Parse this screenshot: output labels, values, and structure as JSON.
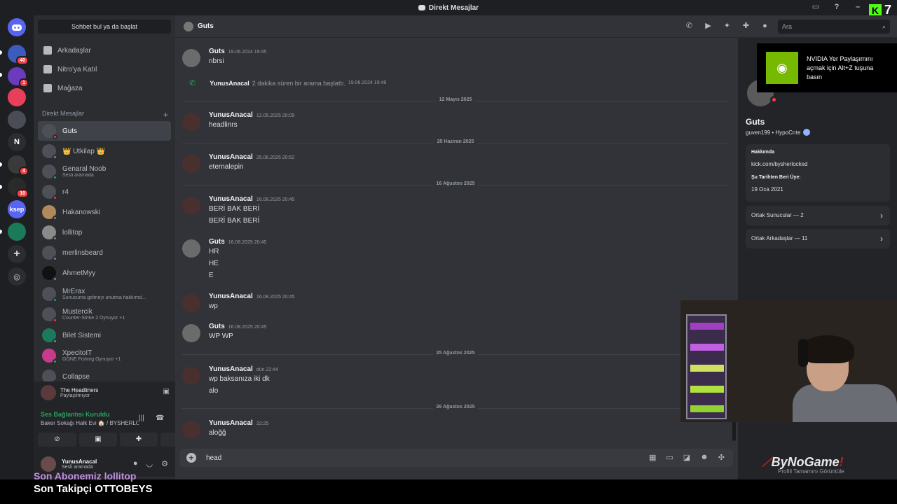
{
  "window": {
    "title": "Direkt Mesajlar"
  },
  "kick": {
    "label": "K",
    "count": "7"
  },
  "servers": [
    {
      "name": "Discord",
      "color": "#5865f2",
      "badge": ""
    },
    {
      "name": "S1",
      "color": "#3b5bbf",
      "badge": "40"
    },
    {
      "name": "S2",
      "color": "#6a3bbf",
      "badge": "1"
    },
    {
      "name": "S3",
      "color": "#e8405a",
      "badge": ""
    },
    {
      "name": "S4",
      "color": "#4a4d55",
      "badge": ""
    },
    {
      "name": "N",
      "color": "#2b2d31",
      "badge": ""
    },
    {
      "name": "S6",
      "color": "#3a3a3a",
      "badge": "4"
    },
    {
      "name": "S7",
      "color": "#2a2a2a",
      "badge": "10"
    },
    {
      "name": "ksep",
      "color": "#5865f2",
      "badge": ""
    },
    {
      "name": "S9",
      "color": "#1a7a5a",
      "badge": ""
    }
  ],
  "sidebar": {
    "search_label": "Sohbet bul ya da başlat",
    "nav": [
      {
        "label": "Arkadaşlar",
        "icon": "friends-icon"
      },
      {
        "label": "Nitro'ya Katıl",
        "icon": "nitro-icon"
      },
      {
        "label": "Mağaza",
        "icon": "shop-icon"
      }
    ],
    "dm_header": "Direkt Mesajlar",
    "dm_add": "+",
    "dms": [
      {
        "name": "Guts",
        "sub": "",
        "status": "dnd",
        "active": true
      },
      {
        "name": "👑 Utkilap 👑",
        "sub": "",
        "status": "off",
        "active": false
      },
      {
        "name": "Genaral Noob",
        "sub": "Sesli aramada",
        "status": "on",
        "active": false
      },
      {
        "name": "r4",
        "sub": "",
        "status": "dnd",
        "active": false
      },
      {
        "name": "Hakanowski",
        "sub": "",
        "status": "off",
        "active": false
      },
      {
        "name": "lollitop",
        "sub": "",
        "status": "off",
        "active": false
      },
      {
        "name": "merlinsbeard",
        "sub": "",
        "status": "off",
        "active": false
      },
      {
        "name": "AhmetMyy",
        "sub": "",
        "status": "off",
        "active": false
      },
      {
        "name": "MrErax",
        "sub": "Sunucuma gelmeyi unutma hakkımd...",
        "status": "on",
        "active": false
      },
      {
        "name": "Mustercik",
        "sub": "Counter-Strike 2 Oynuyor +1",
        "status": "dnd",
        "active": false
      },
      {
        "name": "Bilet Sistemi",
        "sub": "",
        "status": "off",
        "active": false
      },
      {
        "name": "XpecitoIT",
        "sub": "GONE Fishing Oynuyor +1",
        "status": "on",
        "active": false
      },
      {
        "name": "Collapse",
        "sub": "",
        "status": "off",
        "active": false
      }
    ]
  },
  "voice": {
    "stream_title": "The Headliners",
    "stream_sub": "Paylaşılmıyor",
    "connected": "Ses Bağlantısı Kuruldu",
    "channel": "Baker Sokağı Halk Evi 🏠 / BYSHERLO..."
  },
  "user": {
    "name": "YunusAnacal",
    "status": "Sesli aramada"
  },
  "overlay": {
    "line1": "Son Abonemiz lollitop",
    "line2": "Son Takipçi OTTOBEYS"
  },
  "chat": {
    "name": "Guts",
    "search_placeholder": "Ara",
    "composer_text": "head",
    "messages": [
      {
        "author": "Guts",
        "time": "19.06.2024 19:45",
        "lines": [
          "nbrsi"
        ]
      },
      {
        "author": "YunusAnacal",
        "time": "12.05.2025 20:09",
        "lines": [
          "headlinrs"
        ]
      },
      {
        "author": "YunusAnacal",
        "time": "25.06.2025 20:52",
        "lines": [
          "eternalepin"
        ]
      },
      {
        "author": "YunusAnacal",
        "time": "16.08.2025 20:45",
        "lines": [
          "BERİ BAK BERİ",
          "BERİ BAK BERİ"
        ]
      },
      {
        "author": "Guts",
        "time": "16.08.2025 20:45",
        "lines": [
          "HR",
          "HE",
          "E"
        ]
      },
      {
        "author": "YunusAnacal",
        "time": "16.08.2025 20:45",
        "lines": [
          "wp"
        ]
      },
      {
        "author": "Guts",
        "time": "16.08.2025 20:45",
        "lines": [
          "WP WP"
        ]
      },
      {
        "author": "YunusAnacal",
        "time": "dün 22:44",
        "lines": [
          "wp baksanıza iki dk",
          "alo"
        ]
      },
      {
        "author": "YunusAnacal",
        "time": "22:25",
        "lines": [
          "aloğğ"
        ]
      }
    ],
    "system": {
      "author": "YunusAnacal",
      "text": "2 dakika süren bir arama başlattı.",
      "time": "19.06.2024 19:48"
    },
    "dividers": [
      "12 Mayıs 2025",
      "25 Haziran 2025",
      "16 Ağustos 2025",
      "25 Ağustos 2025",
      "26 Ağustos 2025"
    ]
  },
  "profile": {
    "name": "Guts",
    "tag": "guven199 • HypoCrıte",
    "about_label": "Hakkımda",
    "about_value": "kick.com/bysherlocked",
    "member_label": "Şu Tarihten Beri Üye:",
    "member_value": "19 Oca 2021",
    "mutual_servers": "Ortak Sunucular — 2",
    "mutual_friends": "Ortak Arkadaşlar — 11",
    "footer": "Profili Tamamını Görüntüle"
  },
  "nvidia_toast": {
    "text": "NVIDIA Yer Paylaşımını açmak için Alt+Z tuşuna basın"
  },
  "brand": {
    "text": "ByNoGame"
  }
}
